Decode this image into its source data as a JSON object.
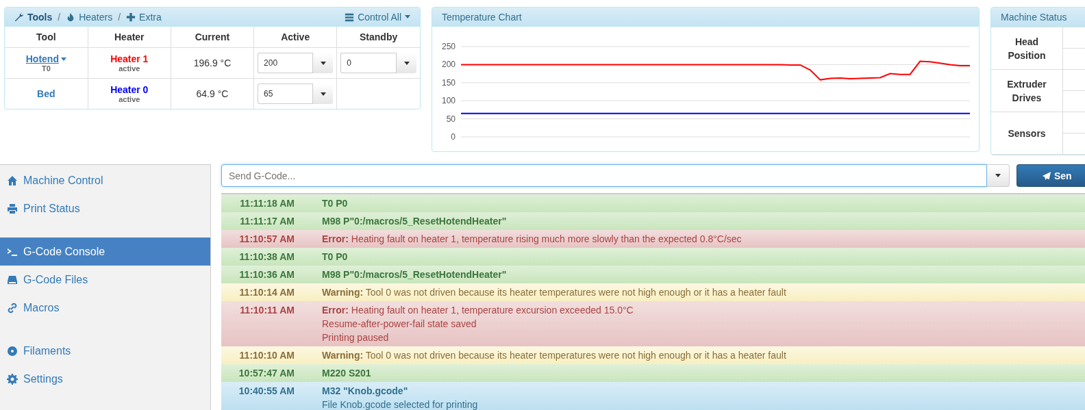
{
  "tools_panel": {
    "breadcrumbs": [
      {
        "label": "Tools",
        "selected": true
      },
      {
        "label": "Heaters",
        "selected": false
      },
      {
        "label": "Extra",
        "selected": false
      }
    ],
    "separator": "/",
    "control_all": "Control All",
    "columns": [
      "Tool",
      "Heater",
      "Current",
      "Active",
      "Standby"
    ],
    "rows": [
      {
        "tool": "Hotend",
        "tool_menu": true,
        "tool_sub": "T0",
        "heater": "Heater 1",
        "color": "#ff0000",
        "heater_state": "active",
        "current": "196.9 °C",
        "active": "200",
        "standby": "0"
      },
      {
        "tool": "Bed",
        "tool_menu": false,
        "heater": "Heater 0",
        "color": "#0000ff",
        "heater_state": "active",
        "current": "64.9 °C",
        "active": "65"
      }
    ]
  },
  "temperature_chart": {
    "title": "Temperature Chart",
    "chart_data": {
      "type": "line",
      "grid": true,
      "ylim": [
        0,
        250
      ],
      "yticks": [
        0,
        50,
        100,
        150,
        200,
        250
      ],
      "series": [
        {
          "color": "#ff0000",
          "values": [
            200,
            200,
            200,
            200,
            200,
            200,
            200,
            200,
            200,
            200,
            200,
            200,
            200,
            200,
            200,
            200,
            200,
            200,
            200,
            200,
            200,
            200,
            200,
            200,
            200,
            200,
            200,
            200,
            200,
            200,
            200,
            200,
            200,
            199,
            199,
            185,
            158,
            162,
            163,
            161,
            162,
            163,
            164,
            175,
            173,
            173,
            209,
            208,
            204,
            200,
            197,
            197
          ]
        },
        {
          "color": "#0000ff",
          "values": [
            65,
            65,
            65,
            65,
            65,
            65,
            65,
            65,
            65,
            65,
            65,
            65,
            65,
            65,
            65,
            65,
            65,
            65,
            65,
            65,
            65,
            65,
            65,
            65,
            65,
            65,
            65,
            65,
            65,
            65,
            65,
            65,
            65,
            65,
            65,
            65,
            65,
            65,
            65,
            65,
            65,
            65,
            65,
            65,
            65,
            65,
            65,
            65,
            65,
            65,
            65,
            65
          ]
        }
      ]
    }
  },
  "machine_status": {
    "title": "Machine Status",
    "groups": [
      "Head Position",
      "Extruder Drives",
      "Sensors"
    ]
  },
  "sidebar": {
    "groups": [
      [
        {
          "label": "Machine Control",
          "selected": false
        },
        {
          "label": "Print Status",
          "selected": false
        }
      ],
      [
        {
          "label": "G-Code Console",
          "selected": true
        },
        {
          "label": "G-Code Files",
          "selected": false
        },
        {
          "label": "Macros",
          "selected": false
        }
      ],
      [
        {
          "label": "Filaments",
          "selected": false
        },
        {
          "label": "Settings",
          "selected": false
        }
      ]
    ]
  },
  "console": {
    "placeholder": "Send G-Code...",
    "send_label": "Sen",
    "entries": [
      {
        "kind": "success",
        "time": "11:11:18 AM",
        "command": "T0 P0"
      },
      {
        "kind": "success",
        "time": "11:11:17 AM",
        "command": "M98 P\"0:/macros/5_ResetHotendHeater\""
      },
      {
        "kind": "error",
        "time": "11:10:57 AM",
        "lines": [
          "**Error:** Heating fault on heater 1, temperature rising much more slowly than the expected 0.8°C/sec"
        ]
      },
      {
        "kind": "success",
        "time": "11:10:38 AM",
        "command": "T0 P0"
      },
      {
        "kind": "success",
        "time": "11:10:36 AM",
        "command": "M98 P\"0:/macros/5_ResetHotendHeater\""
      },
      {
        "kind": "warning",
        "time": "11:10:14 AM",
        "lines": [
          "**Warning:** Tool 0 was not driven because its heater temperatures were not high enough or it has a heater fault"
        ]
      },
      {
        "kind": "error",
        "time": "11:10:11 AM",
        "lines": [
          "**Error:** Heating fault on heater 1, temperature excursion exceeded 15.0°C",
          "Resume-after-power-fail state saved",
          "Printing paused"
        ]
      },
      {
        "kind": "warning",
        "time": "11:10:10 AM",
        "lines": [
          "**Warning:** Tool 0 was not driven because its heater temperatures were not high enough or it has a heater fault"
        ]
      },
      {
        "kind": "success",
        "time": "10:57:47 AM",
        "command": "M220 S201"
      },
      {
        "kind": "info",
        "time": "10:40:55 AM",
        "command": "M32 \"Knob.gcode\"",
        "lines": [
          "File Knob.gcode selected for printing"
        ]
      }
    ]
  }
}
